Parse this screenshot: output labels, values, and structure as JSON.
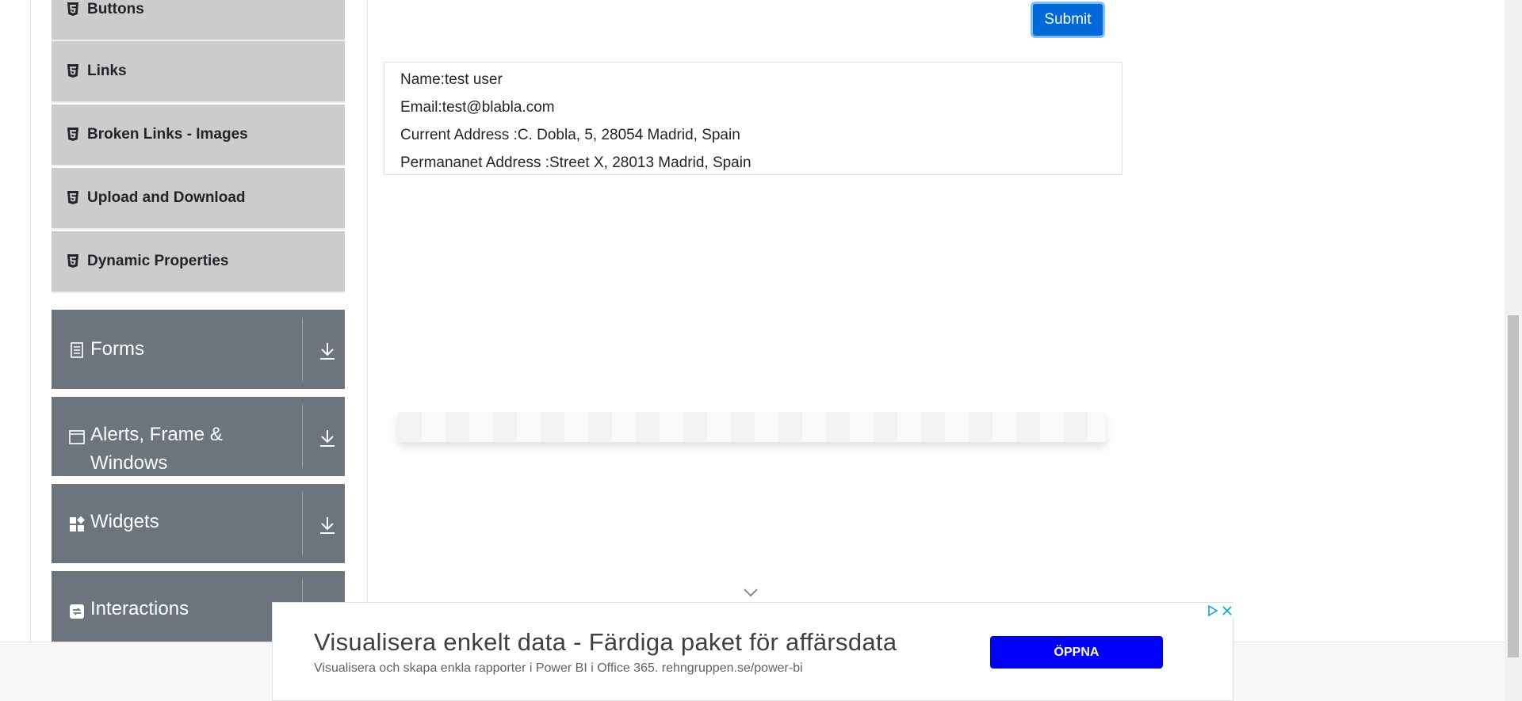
{
  "sidebar": {
    "elements_items": [
      {
        "label": "Buttons",
        "icon": "html5-icon"
      },
      {
        "label": "Links",
        "icon": "html5-icon"
      },
      {
        "label": "Broken Links - Images",
        "icon": "html5-icon"
      },
      {
        "label": "Upload and Download",
        "icon": "html5-icon"
      },
      {
        "label": "Dynamic Properties",
        "icon": "html5-icon"
      }
    ],
    "groups": [
      {
        "label": "Forms",
        "icon": "document-icon"
      },
      {
        "label": "Alerts, Frame & Windows",
        "icon": "window-icon"
      },
      {
        "label": "Widgets",
        "icon": "widgets-icon"
      },
      {
        "label": "Interactions",
        "icon": "interactions-icon"
      }
    ]
  },
  "form": {
    "submit_label": "Submit"
  },
  "output": {
    "name": "Name:test user",
    "email": "Email:test@blabla.com",
    "current_address": "Current Address :C. Dobla, 5, 28054 Madrid, Spain",
    "permanent_address": "Permananet Address :Street X, 28013 Madrid, Spain"
  },
  "ad": {
    "title": "Visualisera enkelt data - Färdiga paket för affärsdata",
    "subtitle": "Visualisera och skapa enkla rapporter i Power BI i Office 365. rehngruppen.se/power-bi",
    "cta_label": "ÖPPNA",
    "cta_color": "#0000ff"
  },
  "colors": {
    "submenu_bg": "#cccccc",
    "group_bg": "#6c757d",
    "primary": "#0069d9"
  }
}
